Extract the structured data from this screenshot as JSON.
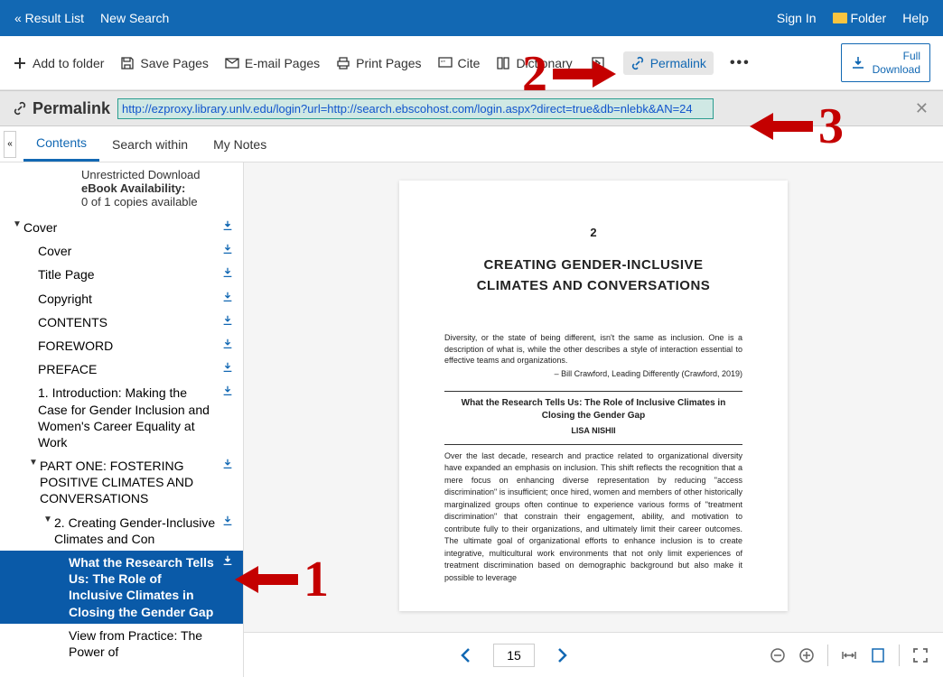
{
  "topbar": {
    "result_list": "« Result List",
    "new_search": "New Search",
    "sign_in": "Sign In",
    "folder": "Folder",
    "help": "Help"
  },
  "toolbar": {
    "add_folder": "Add to folder",
    "save_pages": "Save Pages",
    "email_pages": "E-mail Pages",
    "print_pages": "Print Pages",
    "cite": "Cite",
    "dictionary": "Dictionary",
    "permalink": "Permalink",
    "full_download": "Full\nDownload"
  },
  "permalink": {
    "label": "Permalink",
    "url": "http://ezproxy.library.unlv.edu/login?url=http://search.ebscohost.com/login.aspx?direct=true&db=nlebk&AN=24"
  },
  "tabs": {
    "contents": "Contents",
    "search_within": "Search within",
    "my_notes": "My Notes"
  },
  "sidebar_info": {
    "unrestricted": "Unrestricted Download",
    "avail_label": "eBook Availability:",
    "avail_value": "0 of 1 copies available"
  },
  "toc": {
    "cover": "Cover",
    "cover2": "Cover",
    "title_page": "Title Page",
    "copyright": "Copyright",
    "contents": "CONTENTS",
    "foreword": "FOREWORD",
    "preface": "PREFACE",
    "intro": "1. Introduction: Making the Case for Gender Inclusion and Women's Career Equality at Work",
    "part1": "PART ONE: FOSTERING POSITIVE CLIMATES AND CONVERSATIONS",
    "ch2": "2. Creating Gender-Inclusive Climates and Con",
    "sel": "What the Research Tells Us: The Role of Inclusive Climates in Closing the Gender Gap",
    "view": "View from Practice: The Power of"
  },
  "page": {
    "chnum": "2",
    "chtitle_l1": "CREATING GENDER-INCLUSIVE",
    "chtitle_l2": "CLIMATES AND CONVERSATIONS",
    "quote": "Diversity, or the state of being different, isn't the same as inclusion. One is a description of what is, while the other describes a style of interaction essential to effective teams and organizations.",
    "attrib": "– Bill Crawford, Leading Differently (Crawford, 2019)",
    "subt": "What the Research Tells Us: The Role of Inclusive Climates in Closing the Gender Gap",
    "author": "LISA NISHII",
    "body": "Over the last decade, research and practice related to organizational diversity have expanded an emphasis on inclusion. This shift reflects the recognition that a mere focus on enhancing diverse representation by reducing \"access discrimination\" is insufficient; once hired, women and members of other historically marginalized groups often continue to experience various forms of \"treatment discrimination\" that constrain their engagement, ability, and motivation to contribute fully to their organizations, and ultimately limit their career outcomes. The ultimate goal of organizational efforts to enhance inclusion is to create integrative, multicultural work environments that not only limit experiences of treatment discrimination based on demographic background but also make it possible to leverage"
  },
  "pagenum": "15",
  "annotations": {
    "n1": "1",
    "n2": "2",
    "n3": "3"
  }
}
